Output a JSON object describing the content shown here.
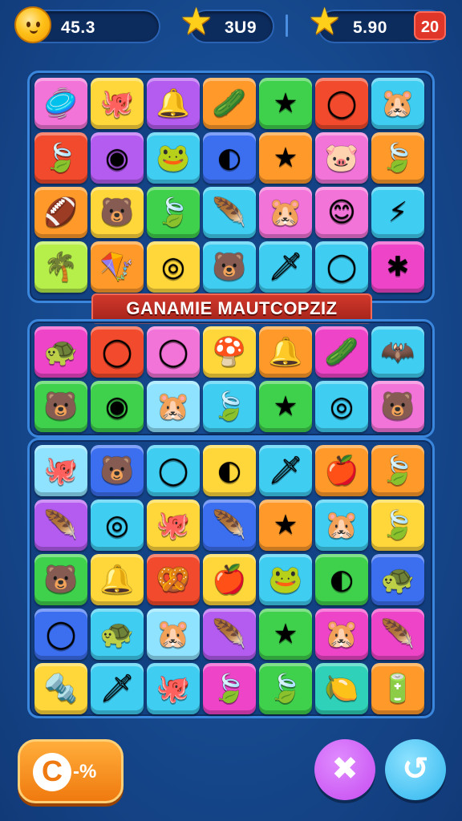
{
  "hud": {
    "coins": "45.3",
    "stars": "3U9",
    "gems": "5.90",
    "level": "20",
    "coin_icon": "smiley-coin-icon",
    "star_icon": "gold-star-icon",
    "gem_icon": "star-gem-icon"
  },
  "banner": "GANAMIE MAUTCOPZIZ",
  "colors": {
    "pink": "#f374d8",
    "yellow": "#ffd73a",
    "purple": "#b45cf0",
    "orange": "#ff9a2a",
    "green": "#3fd04c",
    "red": "#f24a2c",
    "cyan": "#3fcdf2",
    "blue": "#3c6ff0",
    "lime": "#b7ef4a",
    "magenta": "#ee44c8",
    "teal": "#2fd2b8",
    "lightblue": "#8fe3ff"
  },
  "board1": [
    {
      "c": "pink",
      "g": "🥏",
      "n": "paddle-icon"
    },
    {
      "c": "yellow",
      "g": "🐙",
      "n": "red-creature-icon"
    },
    {
      "c": "purple",
      "g": "🔔",
      "n": "bell-icon"
    },
    {
      "c": "orange",
      "g": "🥒",
      "n": "leaf-bug-icon"
    },
    {
      "c": "green",
      "g": "★",
      "n": "star-icon"
    },
    {
      "c": "red",
      "g": "◯",
      "n": "ring-icon"
    },
    {
      "c": "cyan",
      "g": "🐹",
      "n": "bear-face-icon"
    },
    {
      "c": "red",
      "g": "🍃",
      "n": "leaf-icon"
    },
    {
      "c": "purple",
      "g": "◉",
      "n": "eye-icon"
    },
    {
      "c": "cyan",
      "g": "🐸",
      "n": "frog-icon"
    },
    {
      "c": "blue",
      "g": "◐",
      "n": "orb-icon"
    },
    {
      "c": "orange",
      "g": "★",
      "n": "star-icon"
    },
    {
      "c": "pink",
      "g": "🐷",
      "n": "pig-face-icon"
    },
    {
      "c": "orange",
      "g": "🍃",
      "n": "leaf-icon"
    },
    {
      "c": "orange",
      "g": "🏈",
      "n": "ball-icon"
    },
    {
      "c": "yellow",
      "g": "🐻",
      "n": "bear-icon"
    },
    {
      "c": "green",
      "g": "🍃",
      "n": "leaf-icon"
    },
    {
      "c": "cyan",
      "g": "🪶",
      "n": "feather-icon"
    },
    {
      "c": "pink",
      "g": "🐹",
      "n": "bear-face-icon"
    },
    {
      "c": "pink",
      "g": "😊",
      "n": "smiley-icon"
    },
    {
      "c": "cyan",
      "g": "⚡",
      "n": "bolt-icon"
    },
    {
      "c": "lime",
      "g": "🌴",
      "n": "palm-icon"
    },
    {
      "c": "orange",
      "g": "🪁",
      "n": "kite-icon"
    },
    {
      "c": "yellow",
      "g": "◎",
      "n": "donut-icon"
    },
    {
      "c": "cyan",
      "g": "🐻",
      "n": "bear-icon"
    },
    {
      "c": "cyan",
      "g": "🗡",
      "n": "sword-icon"
    },
    {
      "c": "cyan",
      "g": "◯",
      "n": "ring-icon"
    },
    {
      "c": "magenta",
      "g": "✱",
      "n": "splat-icon"
    }
  ],
  "board2": [
    {
      "c": "magenta",
      "g": "🐢",
      "n": "turtle-icon"
    },
    {
      "c": "red",
      "g": "◯",
      "n": "ring-icon"
    },
    {
      "c": "pink",
      "g": "◯",
      "n": "ring-icon"
    },
    {
      "c": "yellow",
      "g": "🍄",
      "n": "mushroom-icon"
    },
    {
      "c": "orange",
      "g": "🔔",
      "n": "bell-icon"
    },
    {
      "c": "magenta",
      "g": "🥒",
      "n": "leaf-bug-icon"
    },
    {
      "c": "cyan",
      "g": "🦇",
      "n": "bat-icon"
    },
    {
      "c": "green",
      "g": "🐻",
      "n": "bear-icon"
    },
    {
      "c": "green",
      "g": "◉",
      "n": "eye-icon"
    },
    {
      "c": "lightblue",
      "g": "🐹",
      "n": "bear-face-icon"
    },
    {
      "c": "cyan",
      "g": "🍃",
      "n": "leaf-icon"
    },
    {
      "c": "green",
      "g": "★",
      "n": "star-icon"
    },
    {
      "c": "cyan",
      "g": "◎",
      "n": "donut-icon"
    },
    {
      "c": "pink",
      "g": "🐻",
      "n": "white-bear-icon"
    }
  ],
  "board3": [
    {
      "c": "lightblue",
      "g": "🐙",
      "n": "octopus-icon"
    },
    {
      "c": "blue",
      "g": "🐻",
      "n": "bear-icon"
    },
    {
      "c": "cyan",
      "g": "◯",
      "n": "ring-icon"
    },
    {
      "c": "yellow",
      "g": "◐",
      "n": "orb-icon"
    },
    {
      "c": "cyan",
      "g": "🗡",
      "n": "sword-icon"
    },
    {
      "c": "orange",
      "g": "🍎",
      "n": "apple-icon"
    },
    {
      "c": "orange",
      "g": "🍃",
      "n": "leaf-icon"
    },
    {
      "c": "purple",
      "g": "🪶",
      "n": "feather-icon"
    },
    {
      "c": "cyan",
      "g": "◎",
      "n": "spiral-icon"
    },
    {
      "c": "yellow",
      "g": "🐙",
      "n": "creature-icon"
    },
    {
      "c": "blue",
      "g": "🪶",
      "n": "feather-icon"
    },
    {
      "c": "orange",
      "g": "★",
      "n": "star-icon"
    },
    {
      "c": "cyan",
      "g": "🐹",
      "n": "bear-face-icon"
    },
    {
      "c": "yellow",
      "g": "🍃",
      "n": "leaf-icon"
    },
    {
      "c": "green",
      "g": "🐻",
      "n": "bear-icon"
    },
    {
      "c": "yellow",
      "g": "🔔",
      "n": "bell-icon"
    },
    {
      "c": "red",
      "g": "🥨",
      "n": "knot-icon"
    },
    {
      "c": "yellow",
      "g": "🍎",
      "n": "apple-icon"
    },
    {
      "c": "cyan",
      "g": "🐸",
      "n": "frog-icon"
    },
    {
      "c": "green",
      "g": "◐",
      "n": "orb-icon"
    },
    {
      "c": "blue",
      "g": "🐢",
      "n": "turtle-icon"
    },
    {
      "c": "blue",
      "g": "◯",
      "n": "ring-icon"
    },
    {
      "c": "cyan",
      "g": "🐢",
      "n": "turtle-icon"
    },
    {
      "c": "lightblue",
      "g": "🐹",
      "n": "bear-face-icon"
    },
    {
      "c": "purple",
      "g": "🪶",
      "n": "feather-icon"
    },
    {
      "c": "green",
      "g": "★",
      "n": "star-icon"
    },
    {
      "c": "magenta",
      "g": "🐹",
      "n": "bear-face-icon"
    },
    {
      "c": "magenta",
      "g": "🪶",
      "n": "feather-icon"
    },
    {
      "c": "yellow",
      "g": "🔩",
      "n": "bolt-tool-icon"
    },
    {
      "c": "cyan",
      "g": "🗡",
      "n": "sword-icon"
    },
    {
      "c": "cyan",
      "g": "🐙",
      "n": "creature-icon"
    },
    {
      "c": "magenta",
      "g": "🍃",
      "n": "leaf-icon"
    },
    {
      "c": "green",
      "g": "🍃",
      "n": "leaf-icon"
    },
    {
      "c": "teal",
      "g": "🍋",
      "n": "lemon-icon"
    },
    {
      "c": "orange",
      "g": "🔋",
      "n": "battery-icon"
    }
  ],
  "buttons": {
    "left_icon": "C",
    "left_label": "-%",
    "left_icon_name": "undo-icon",
    "shuffle_glyph": "✖",
    "shuffle_icon_name": "shuffle-icon",
    "hint_glyph": "↺",
    "hint_icon_name": "hint-icon",
    "shuffle_color": "#c64bf0",
    "hint_color": "#2fb6ee"
  }
}
